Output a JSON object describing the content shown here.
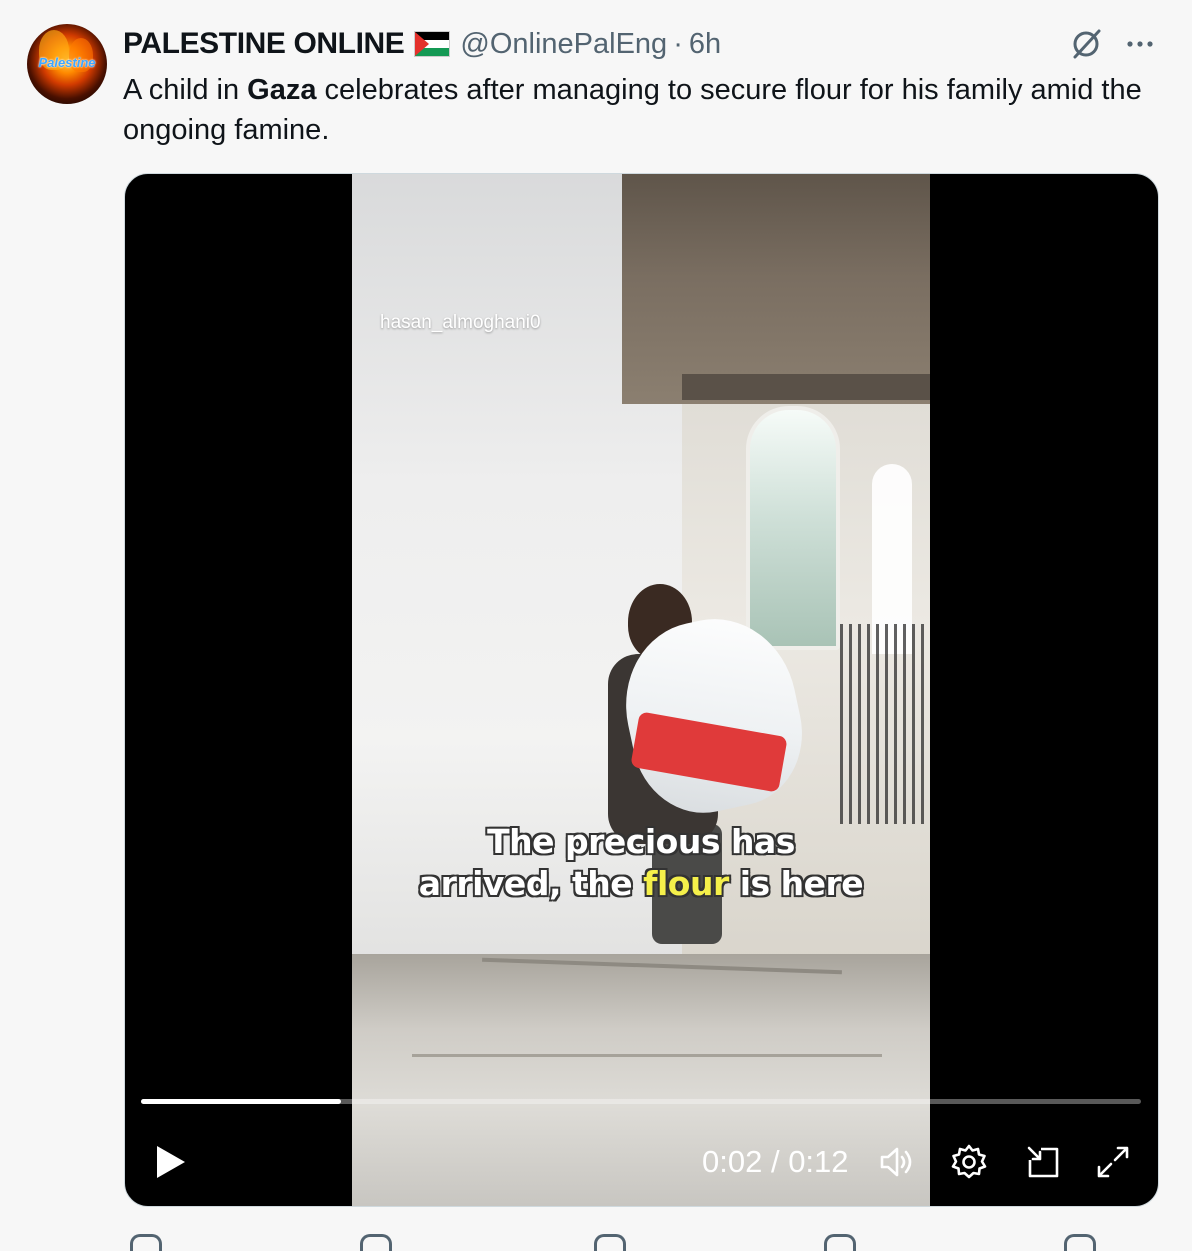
{
  "post": {
    "avatar_text": "Palestine",
    "author_name": "PALESTINE ONLINE",
    "author_flag_icon": "palestine-flag-icon",
    "handle": "@OnlinePalEng",
    "separator": "·",
    "time_ago": "6h",
    "text_before": "A child in ",
    "text_bold": "Gaza",
    "text_after": " celebrates after managing to secure flour for his family amid the ongoing famine.",
    "icons": {
      "grok": "grok-icon",
      "more": "more-icon"
    }
  },
  "video": {
    "watermark": "hasan_almoghani0",
    "caption_line1": "The precious has",
    "caption_line2_a": "arrived, the ",
    "caption_line2_highlight": "flour",
    "caption_line2_b": " is here",
    "highlight_color": "#f5f04a",
    "progress": 0.2,
    "current_time": "0:02",
    "time_separator": " / ",
    "duration": "0:12",
    "controls": [
      "play-icon",
      "volume-icon",
      "settings-icon",
      "pip-icon",
      "fullscreen-icon"
    ]
  }
}
